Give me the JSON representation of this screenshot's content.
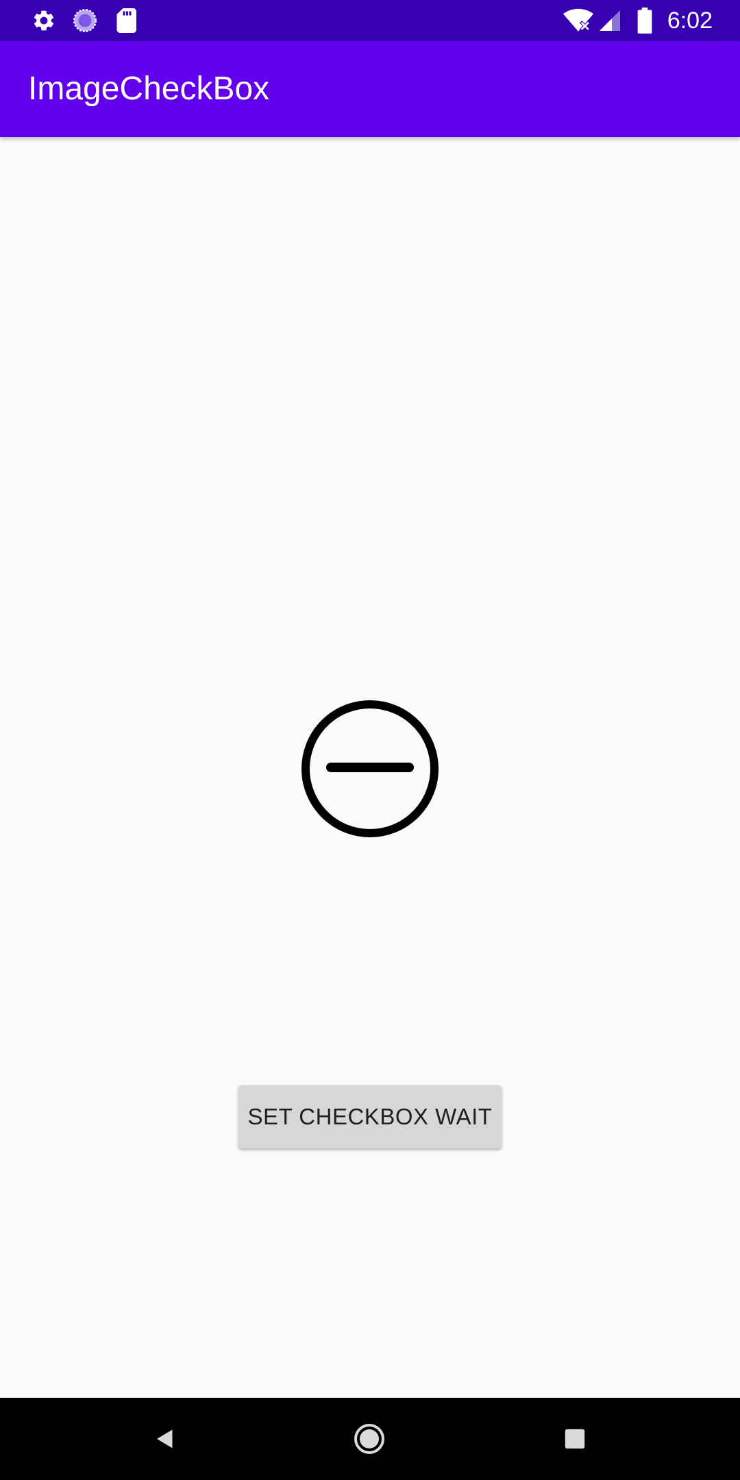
{
  "status_bar": {
    "time": "6:02",
    "left_icons": [
      "settings-icon",
      "sync-icon",
      "sd-card-icon"
    ],
    "right_icons": [
      "wifi-off-icon",
      "cell-signal-icon",
      "battery-icon"
    ]
  },
  "app_bar": {
    "title": "ImageCheckBox"
  },
  "main": {
    "checkbox_state_icon": "minus-circle-icon",
    "button_label": "SET CHECKBOX WAIT"
  },
  "nav_bar": {
    "buttons": [
      "back-icon",
      "home-icon",
      "recents-icon"
    ]
  },
  "colors": {
    "status_bar": "#3700b3",
    "app_bar": "#6200ee",
    "background": "#fafafa",
    "button": "#d6d7d7",
    "nav_bar": "#000000"
  }
}
